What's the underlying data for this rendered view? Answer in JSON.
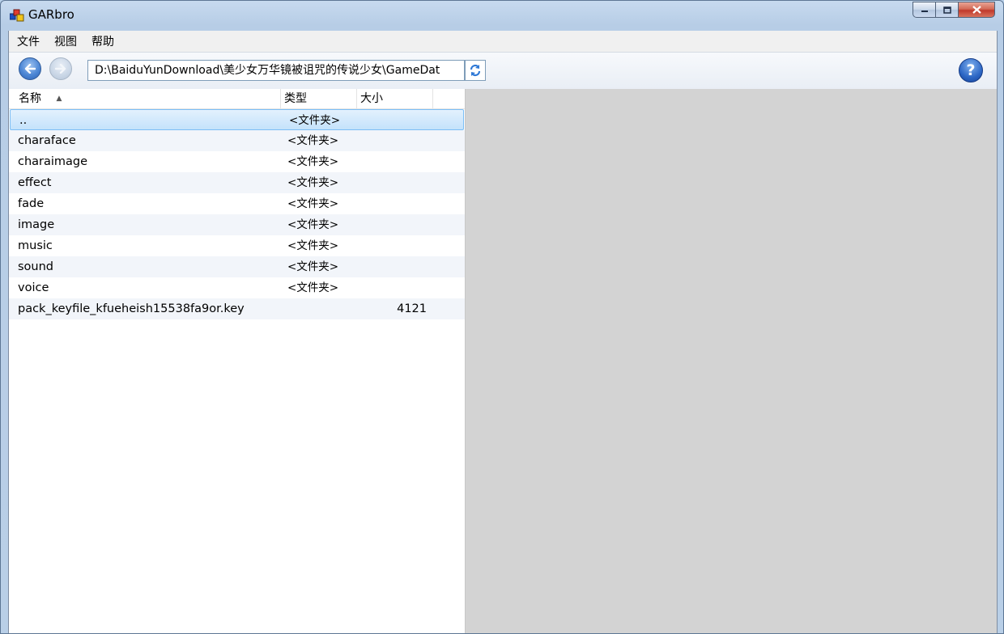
{
  "window": {
    "title": "GARbro"
  },
  "menu": {
    "items": [
      "文件",
      "视图",
      "帮助"
    ]
  },
  "toolbar": {
    "path": "D:\\BaiduYunDownload\\美少女万华镜被诅咒的传说少女\\GameDat",
    "help_label": "?"
  },
  "list": {
    "columns": {
      "name": "名称",
      "type": "类型",
      "size": "大小"
    },
    "sort": {
      "column": "name",
      "direction": "ascending"
    },
    "rows": [
      {
        "name": "..",
        "type": "<文件夹>",
        "size": ""
      },
      {
        "name": "charaface",
        "type": "<文件夹>",
        "size": ""
      },
      {
        "name": "charaimage",
        "type": "<文件夹>",
        "size": ""
      },
      {
        "name": "effect",
        "type": "<文件夹>",
        "size": ""
      },
      {
        "name": "fade",
        "type": "<文件夹>",
        "size": ""
      },
      {
        "name": "image",
        "type": "<文件夹>",
        "size": ""
      },
      {
        "name": "music",
        "type": "<文件夹>",
        "size": ""
      },
      {
        "name": "sound",
        "type": "<文件夹>",
        "size": ""
      },
      {
        "name": "voice",
        "type": "<文件夹>",
        "size": ""
      },
      {
        "name": "pack_keyfile_kfueheish15538fa9or.key",
        "type": "",
        "size": "4121"
      }
    ]
  },
  "colors": {
    "selection": "#c4e2fb",
    "preview_bg": "#d3d3d3"
  }
}
